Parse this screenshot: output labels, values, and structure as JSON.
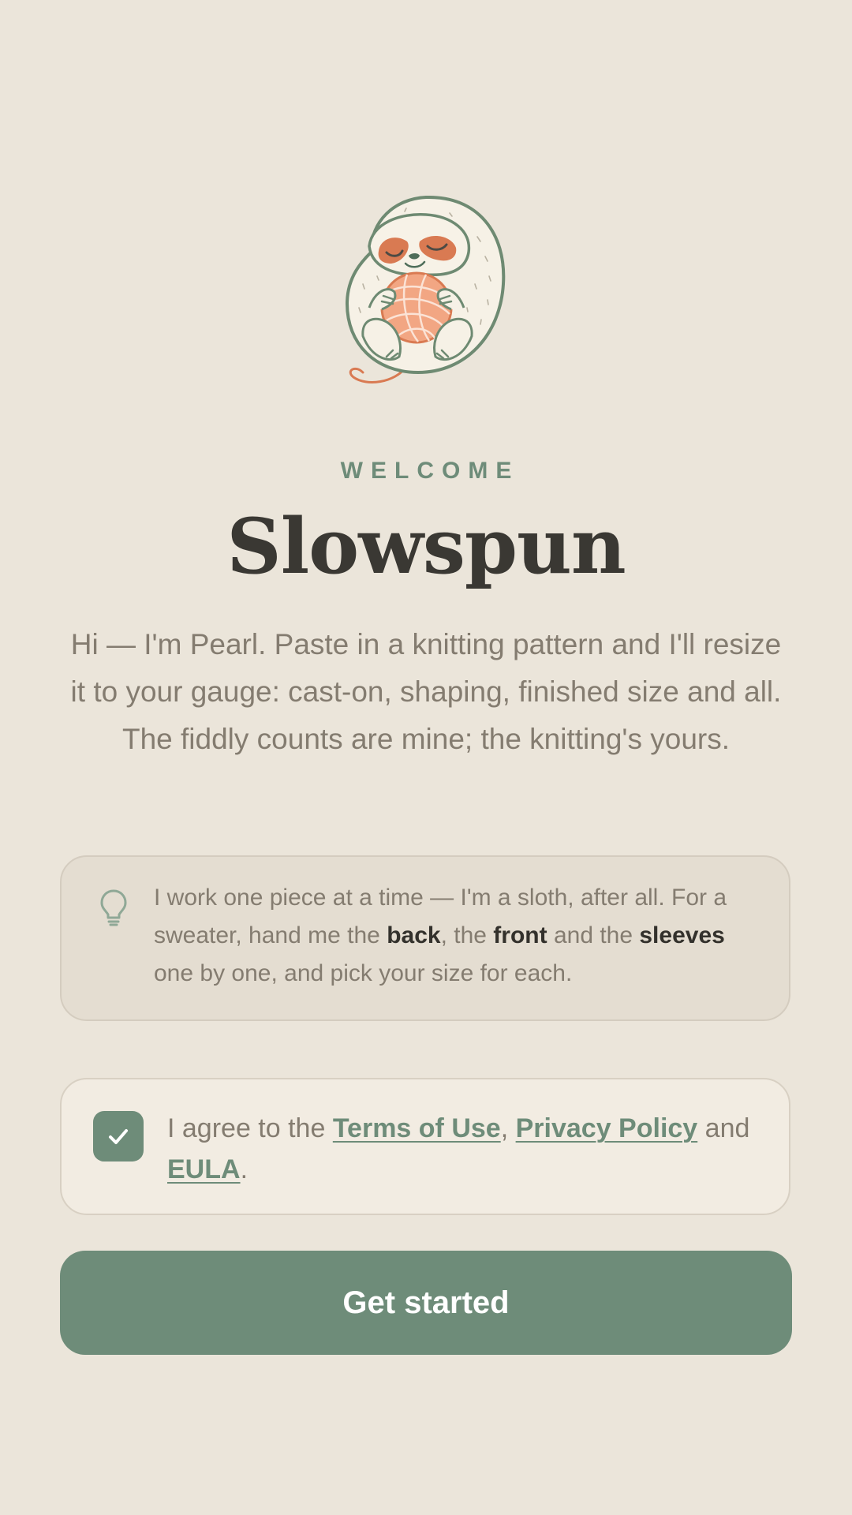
{
  "colors": {
    "background": "#ebe5da",
    "accent": "#6e8c79",
    "title": "#3a3833",
    "body_text": "#847c70",
    "mascot_accent": "#d97a52"
  },
  "mascot": {
    "icon": "sloth-holding-yarn-ball-icon"
  },
  "welcome": {
    "eyebrow": "WELCOME",
    "title": "Slowspun",
    "intro": "Hi — I'm Pearl. Paste in a knitting pattern and I'll resize it to your gauge: cast-on, shaping, finished size and all. The fiddly counts are mine; the knitting's yours."
  },
  "tip": {
    "icon": "lightbulb-icon",
    "text_1": "I work one piece at a time — I'm a sloth, after all. For a sweater, hand me the ",
    "bold_1": "back",
    "text_2": ", the ",
    "bold_2": "front",
    "text_3": " and the ",
    "bold_3": "sleeves",
    "text_4": " one by one, and pick your size for each."
  },
  "agreement": {
    "checked": true,
    "prefix": "I agree to the ",
    "terms_link": "Terms of Use",
    "separator": ", ",
    "privacy_link": "Privacy Policy",
    "conjunction": " and ",
    "eula_link": "EULA",
    "suffix": "."
  },
  "cta": {
    "label": "Get started"
  }
}
